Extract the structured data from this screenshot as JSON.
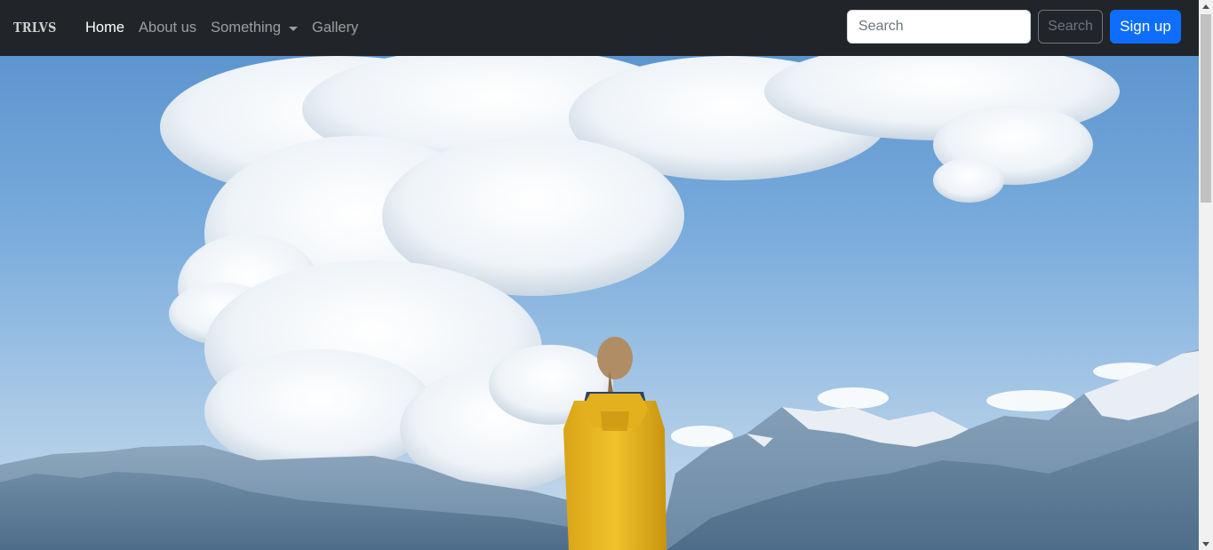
{
  "brand": {
    "text": "TRLVS",
    "icon": "logo-icon"
  },
  "nav": {
    "items": [
      {
        "label": "Home",
        "active": true
      },
      {
        "label": "About us",
        "active": false
      },
      {
        "label": "Something",
        "active": false,
        "dropdown": true
      },
      {
        "label": "Gallery",
        "active": false
      }
    ]
  },
  "search": {
    "placeholder": "Search",
    "button_label": "Search"
  },
  "signup": {
    "label": "Sign up"
  },
  "colors": {
    "navbar": "#212529",
    "primary": "#0d6efd",
    "sky": "#79abdc",
    "jacket": "#e2b11c"
  },
  "hero": {
    "icon": "hero-image"
  }
}
